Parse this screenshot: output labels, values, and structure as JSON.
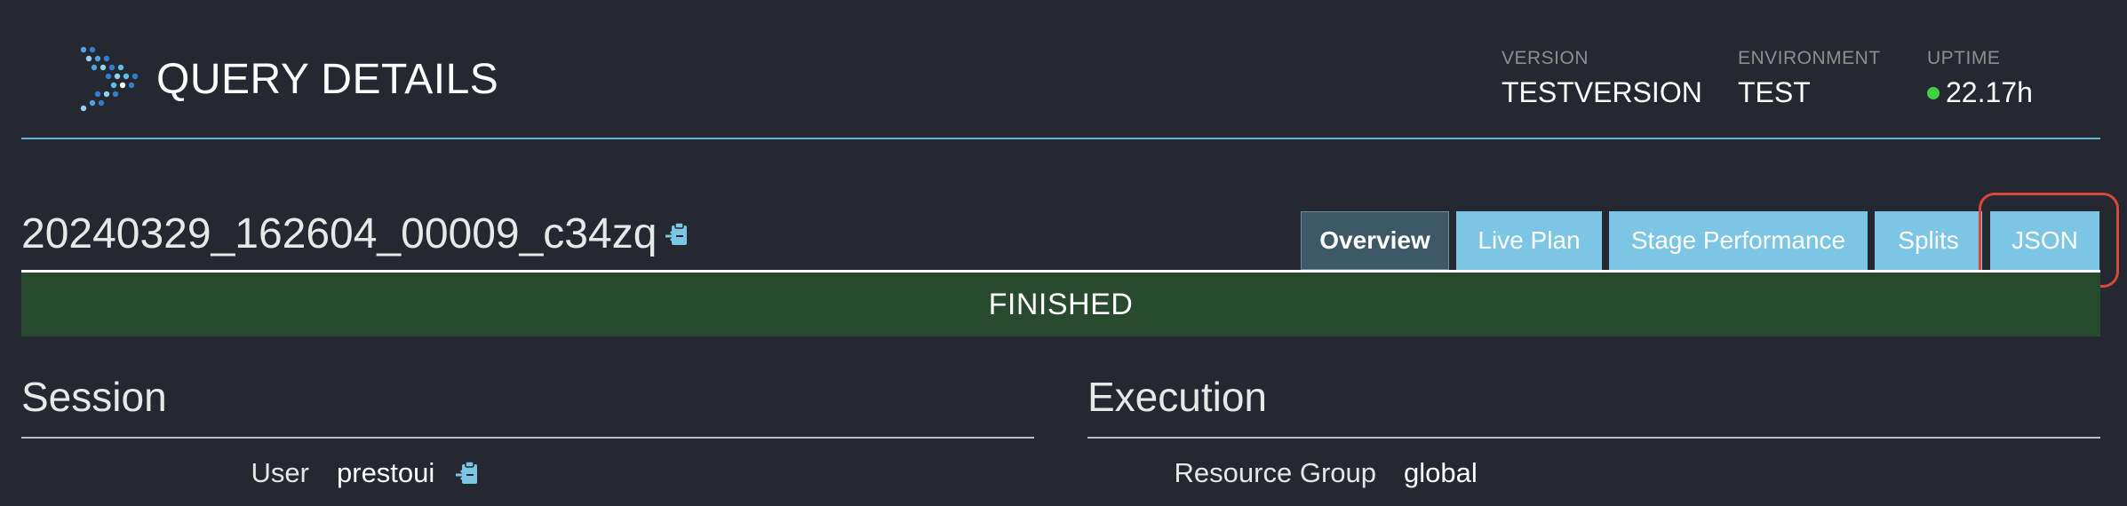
{
  "header": {
    "title": "QUERY DETAILS",
    "version": {
      "label": "VERSION",
      "value": "TESTVERSION"
    },
    "environment": {
      "label": "ENVIRONMENT",
      "value": "TEST"
    },
    "uptime": {
      "label": "UPTIME",
      "value": "22.17h",
      "status_color": "#3fd13f"
    }
  },
  "query": {
    "id": "20240329_162604_00009_c34zq",
    "copy_icon": "clipboard-icon"
  },
  "tabs": [
    {
      "label": "Overview",
      "active": true
    },
    {
      "label": "Live Plan",
      "active": false
    },
    {
      "label": "Stage Performance",
      "active": false
    },
    {
      "label": "Splits",
      "active": false
    },
    {
      "label": "JSON",
      "active": false
    }
  ],
  "state": {
    "text": "FINISHED",
    "color": "#284a2e"
  },
  "session": {
    "title": "Session",
    "rows": [
      {
        "label": "User",
        "value": "prestoui",
        "icon": "clipboard-icon"
      }
    ]
  },
  "execution": {
    "title": "Execution",
    "rows": [
      {
        "label": "Resource Group",
        "value": "global"
      }
    ]
  },
  "colors": {
    "background": "#252830",
    "accent": "#7cc5e5",
    "active_tab": "#3d5866",
    "highlight": "#d9473a"
  }
}
